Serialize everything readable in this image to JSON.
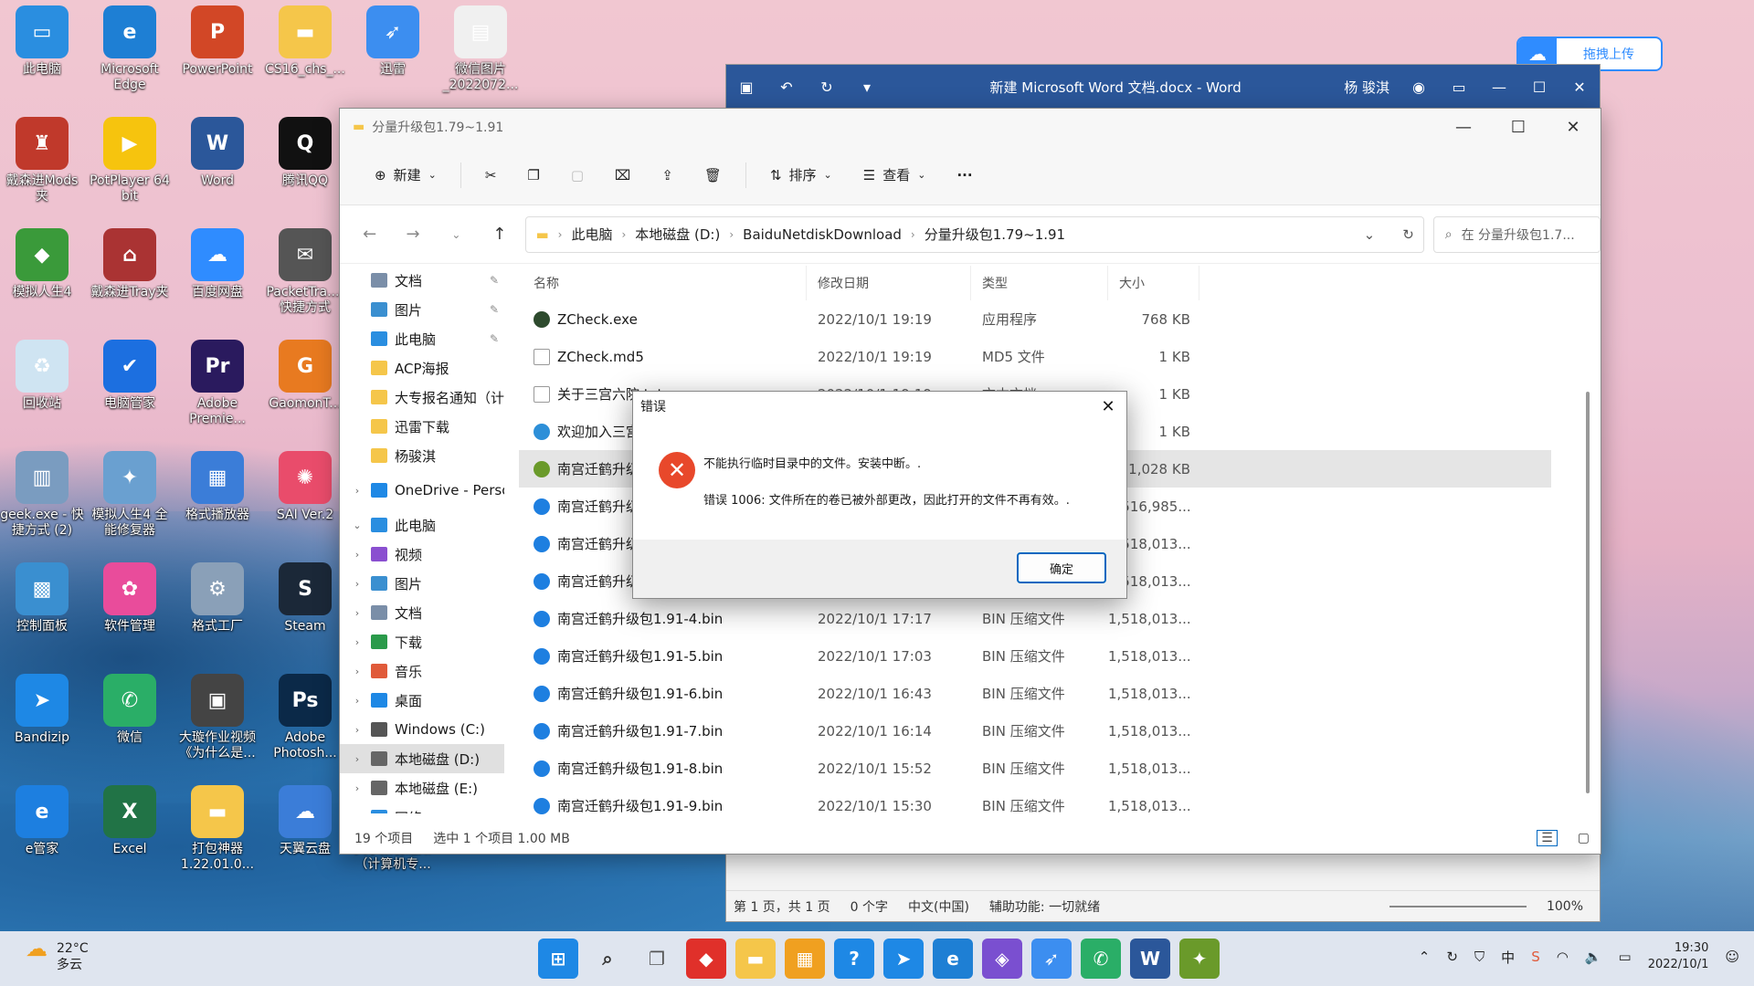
{
  "desktop_icons": [
    {
      "label": "此电脑",
      "color": "#2a8ee0",
      "glyph": "▭"
    },
    {
      "label": "Microsoft Edge",
      "color": "#1e7fd4",
      "glyph": "e"
    },
    {
      "label": "PowerPoint",
      "color": "#d24726",
      "glyph": "P"
    },
    {
      "label": "CS16_chs_...",
      "color": "#f5c64a",
      "glyph": "▬"
    },
    {
      "label": "迅雷",
      "color": "#3c8ef0",
      "glyph": "➶"
    },
    {
      "label": "微信图片_2022072...",
      "color": "#f0f0f0",
      "glyph": "▤"
    },
    {
      "label": "戴森进Mods夹",
      "color": "#c0392b",
      "glyph": "♜"
    },
    {
      "label": "PotPlayer 64 bit",
      "color": "#f6c40e",
      "glyph": "▶"
    },
    {
      "label": "Word",
      "color": "#2b579a",
      "glyph": "W"
    },
    {
      "label": "腾讯QQ",
      "color": "#111111",
      "glyph": "Q"
    },
    {
      "label": "模拟人生4",
      "color": "#3a9a3a",
      "glyph": "◆"
    },
    {
      "label": "戴森进Tray夹",
      "color": "#a33",
      "glyph": "⌂"
    },
    {
      "label": "百度网盘",
      "color": "#2f8cff",
      "glyph": "☁"
    },
    {
      "label": "PacketTra...- 快捷方式",
      "color": "#555",
      "glyph": "✉"
    },
    {
      "label": "回收站",
      "color": "#cfe4f2",
      "glyph": "♻"
    },
    {
      "label": "电脑管家",
      "color": "#1c6fe0",
      "glyph": "✔"
    },
    {
      "label": "Adobe Premie...",
      "color": "#2a1a5e",
      "glyph": "Pr"
    },
    {
      "label": "GaomonT...",
      "color": "#e87a20",
      "glyph": "G"
    },
    {
      "label": "geek.exe - 快捷方式 (2)",
      "color": "#7a9cc0",
      "glyph": "▥"
    },
    {
      "label": "模拟人生4 全能修复器",
      "color": "#6aa0d0",
      "glyph": "✦"
    },
    {
      "label": "格式播放器",
      "color": "#3b7dd8",
      "glyph": "▦"
    },
    {
      "label": "SAI Ver.2",
      "color": "#e94c6b",
      "glyph": "✺"
    },
    {
      "label": "控制面板",
      "color": "#3a8fd0",
      "glyph": "▩"
    },
    {
      "label": "软件管理",
      "color": "#e94c9b",
      "glyph": "✿"
    },
    {
      "label": "格式工厂",
      "color": "#8aa0b8",
      "glyph": "⚙"
    },
    {
      "label": "Steam",
      "color": "#1b2838",
      "glyph": "S"
    },
    {
      "label": "Bandizip",
      "color": "#1e88e5",
      "glyph": "➤"
    },
    {
      "label": "微信",
      "color": "#2aae67",
      "glyph": "✆"
    },
    {
      "label": "大璇作业视频《为什么是...",
      "color": "#444",
      "glyph": "▣"
    },
    {
      "label": "Adobe Photosh...",
      "color": "#0b2948",
      "glyph": "Ps"
    },
    {
      "label": "e管家",
      "color": "#1d7fe0",
      "glyph": "e"
    },
    {
      "label": "Excel",
      "color": "#217346",
      "glyph": "X"
    },
    {
      "label": "打包神器 1.22.01.0...",
      "color": "#f5c64a",
      "glyph": "▬"
    },
    {
      "label": "天翼云盘",
      "color": "#3b7dd8",
      "glyph": "☁"
    },
    {
      "label": "大学报名通知（计算机专...",
      "color": "#f5c64a",
      "glyph": "▬"
    }
  ],
  "baidu_upload": {
    "label": "拖拽上传"
  },
  "word": {
    "title": "新建 Microsoft Word 文档.docx  -  Word",
    "user": "杨 骏淇",
    "status": {
      "page": "第 1 页，共 1 页",
      "words": "0 个字",
      "lang": "中文(中国)",
      "access": "辅助功能: 一切就绪",
      "zoom": "100%"
    }
  },
  "explorer": {
    "title": "分量升级包1.79~1.91",
    "toolbar": {
      "new": "新建",
      "sort": "排序",
      "view": "查看",
      "more": "···"
    },
    "breadcrumb": [
      "此电脑",
      "本地磁盘 (D:)",
      "BaiduNetdiskDownload",
      "分量升级包1.79~1.91"
    ],
    "search_placeholder": "在 分量升级包1.7...",
    "sidebar": [
      {
        "label": "文档",
        "color": "#7a8ea8",
        "pin": true,
        "chev": ""
      },
      {
        "label": "图片",
        "color": "#3a8fd0",
        "pin": true,
        "chev": ""
      },
      {
        "label": "此电脑",
        "color": "#2a8ee0",
        "pin": true,
        "chev": ""
      },
      {
        "label": "ACP海报",
        "color": "#f5c64a",
        "pin": false,
        "chev": ""
      },
      {
        "label": "大专报名通知（计",
        "color": "#f5c64a",
        "pin": false,
        "chev": ""
      },
      {
        "label": "迅雷下载",
        "color": "#f5c64a",
        "pin": false,
        "chev": ""
      },
      {
        "label": "杨骏淇",
        "color": "#f5c64a",
        "pin": false,
        "chev": ""
      },
      {
        "label": "OneDrive - Perso",
        "color": "#1e88e5",
        "pin": false,
        "chev": "›"
      },
      {
        "label": "此电脑",
        "color": "#2a8ee0",
        "pin": false,
        "chev": "⌄"
      },
      {
        "label": "视频",
        "color": "#8a4fd0",
        "pin": false,
        "chev": "›"
      },
      {
        "label": "图片",
        "color": "#3a8fd0",
        "pin": false,
        "chev": "›"
      },
      {
        "label": "文档",
        "color": "#7a8ea8",
        "pin": false,
        "chev": "›"
      },
      {
        "label": "下载",
        "color": "#2a9a4a",
        "pin": false,
        "chev": "›"
      },
      {
        "label": "音乐",
        "color": "#e05a3a",
        "pin": false,
        "chev": "›"
      },
      {
        "label": "桌面",
        "color": "#1e88e5",
        "pin": false,
        "chev": "›"
      },
      {
        "label": "Windows (C:)",
        "color": "#555",
        "pin": false,
        "chev": "›"
      },
      {
        "label": "本地磁盘 (D:)",
        "color": "#666",
        "pin": false,
        "chev": "›"
      },
      {
        "label": "本地磁盘 (E:)",
        "color": "#666",
        "pin": false,
        "chev": "›"
      },
      {
        "label": "网络",
        "color": "#2a8ee0",
        "pin": false,
        "chev": "›"
      }
    ],
    "columns": [
      "名称",
      "修改日期",
      "类型",
      "大小"
    ],
    "files": [
      {
        "name": "ZCheck.exe",
        "date": "2022/10/1 19:19",
        "type": "应用程序",
        "size": "768 KB",
        "color": "#2d4a2d"
      },
      {
        "name": "ZCheck.md5",
        "date": "2022/10/1 19:19",
        "type": "MD5 文件",
        "size": "1 KB",
        "color": "#ffffff"
      },
      {
        "name": "关于三宫六院.txt",
        "date": "2022/10/1 19:19",
        "type": "文本文档",
        "size": "1 KB",
        "color": "#ffffff"
      },
      {
        "name": "欢迎加入三宫六院",
        "date": "",
        "type": "",
        "size": "1 KB",
        "color": "#2d8fd8"
      },
      {
        "name": "南宫迁鹤升级包",
        "date": "",
        "type": "",
        "size": "1,028 KB",
        "color": "#6a9a2a"
      },
      {
        "name": "南宫迁鹤升级包",
        "date": "",
        "type": "",
        "size": "1,516,985...",
        "color": "#1e7fe0"
      },
      {
        "name": "南宫迁鹤升级包",
        "date": "",
        "type": "",
        "size": "1,518,013...",
        "color": "#1e7fe0"
      },
      {
        "name": "南宫迁鹤升级包",
        "date": "",
        "type": "",
        "size": "1,518,013...",
        "color": "#1e7fe0"
      },
      {
        "name": "南宫迁鹤升级包1.91-4.bin",
        "date": "2022/10/1 17:17",
        "type": "BIN 压缩文件",
        "size": "1,518,013...",
        "color": "#1e7fe0"
      },
      {
        "name": "南宫迁鹤升级包1.91-5.bin",
        "date": "2022/10/1 17:03",
        "type": "BIN 压缩文件",
        "size": "1,518,013...",
        "color": "#1e7fe0"
      },
      {
        "name": "南宫迁鹤升级包1.91-6.bin",
        "date": "2022/10/1 16:43",
        "type": "BIN 压缩文件",
        "size": "1,518,013...",
        "color": "#1e7fe0"
      },
      {
        "name": "南宫迁鹤升级包1.91-7.bin",
        "date": "2022/10/1 16:14",
        "type": "BIN 压缩文件",
        "size": "1,518,013...",
        "color": "#1e7fe0"
      },
      {
        "name": "南宫迁鹤升级包1.91-8.bin",
        "date": "2022/10/1 15:52",
        "type": "BIN 压缩文件",
        "size": "1,518,013...",
        "color": "#1e7fe0"
      },
      {
        "name": "南宫迁鹤升级包1.91-9.bin",
        "date": "2022/10/1 15:30",
        "type": "BIN 压缩文件",
        "size": "1,518,013...",
        "color": "#1e7fe0"
      }
    ],
    "selected_row": 4,
    "status": {
      "count": "19 个项目",
      "selected": "选中 1 个项目  1.00 MB"
    }
  },
  "dialog": {
    "title": "错误",
    "message1": "不能执行临时目录中的文件。安装中断。.",
    "message2": "错误 1006: 文件所在的卷已被外部更改，因此打开的文件不再有效。.",
    "ok": "确定"
  },
  "taskbar": {
    "weather_temp": "22°C",
    "weather_desc": "多云",
    "apps": [
      {
        "name": "start",
        "color": "#1e88e5",
        "glyph": "⊞"
      },
      {
        "name": "search",
        "color": "#333",
        "glyph": "⌕"
      },
      {
        "name": "task-view",
        "color": "#555",
        "glyph": "❐"
      },
      {
        "name": "app-red",
        "color": "#e0302a",
        "glyph": "◆"
      },
      {
        "name": "file-explorer",
        "color": "#f5c64a",
        "glyph": "▬"
      },
      {
        "name": "store",
        "color": "#f0a020",
        "glyph": "▦"
      },
      {
        "name": "help",
        "color": "#1e88e5",
        "glyph": "?"
      },
      {
        "name": "bandizip",
        "color": "#1e88e5",
        "glyph": "➤"
      },
      {
        "name": "edge",
        "color": "#1e7fd4",
        "glyph": "e"
      },
      {
        "name": "visual-studio",
        "color": "#7a4fd0",
        "glyph": "◈"
      },
      {
        "name": "xunlei",
        "color": "#3c8ef0",
        "glyph": "➶"
      },
      {
        "name": "wechat",
        "color": "#2aae67",
        "glyph": "✆"
      },
      {
        "name": "word",
        "color": "#2b579a",
        "glyph": "W"
      },
      {
        "name": "installer",
        "color": "#6a9a2a",
        "glyph": "✦"
      }
    ],
    "ime": "中",
    "time": "19:30",
    "date": "2022/10/1"
  }
}
